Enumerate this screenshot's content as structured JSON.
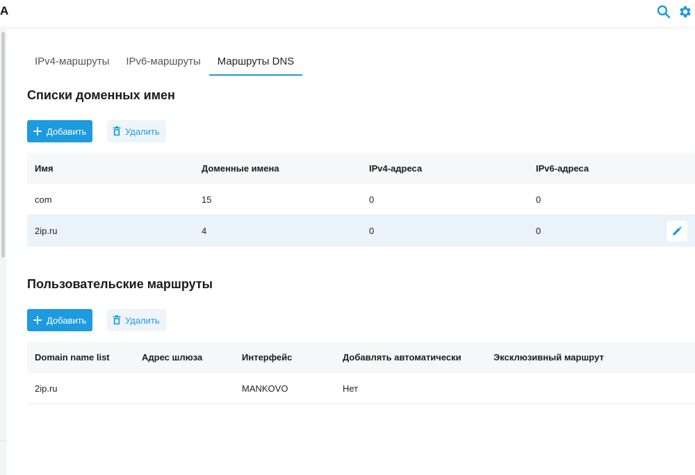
{
  "header": {
    "logo_fragment": "A",
    "search_icon": "search-icon",
    "settings_icon": "gear-icon",
    "accent_color": "#1d9ae0"
  },
  "tabs": [
    {
      "label": "IPv4-маршруты",
      "active": false
    },
    {
      "label": "IPv6-маршруты",
      "active": false
    },
    {
      "label": "Маршруты DNS",
      "active": true
    }
  ],
  "domain_lists": {
    "title": "Списки доменных имен",
    "add_label": "Добавить",
    "delete_label": "Удалить",
    "columns": [
      "Имя",
      "Доменные имена",
      "IPv4-адреса",
      "IPv6-адреса"
    ],
    "rows": [
      [
        "com",
        "15",
        "0",
        "0"
      ],
      [
        "2ip.ru",
        "4",
        "0",
        "0"
      ]
    ],
    "edit_icon": "pencil-icon"
  },
  "custom_routes": {
    "title": "Пользовательские маршруты",
    "add_label": "Добавить",
    "delete_label": "Удалить",
    "columns": [
      "Domain name list",
      "Адрес шлюза",
      "Интерфейс",
      "Добавлять автоматически",
      "Эксклюзивный маршрут"
    ],
    "rows": [
      [
        "2ip.ru",
        "",
        "MANKOVO",
        "Нет",
        ""
      ]
    ]
  }
}
